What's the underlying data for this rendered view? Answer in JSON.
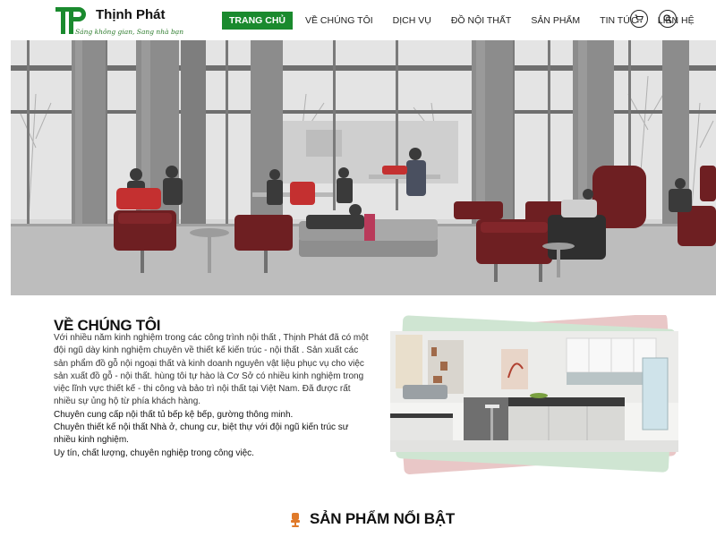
{
  "brand": {
    "name": "Thịnh Phát",
    "tagline": "Sáng không gian, Sang nhà bạn",
    "green": "#1a8a2e"
  },
  "nav": {
    "items": [
      "TRANG CHỦ",
      "VỀ CHÚNG TÔI",
      "DỊCH VỤ",
      "ĐỒ NỘI THẤT",
      "SẢN PHẨM",
      "TIN TỨC",
      "LIÊN HỆ"
    ],
    "active_index": 0,
    "cart_icon": "cart-icon",
    "search_icon": "search-icon"
  },
  "about": {
    "title": "VỀ CHÚNG TÔI",
    "paragraph": "Với nhiều năm kinh nghiệm trong các công trình nội thất , Thịnh Phát đã có một đội ngũ dày kinh nghiệm chuyên về thiết kế kiến trúc - nội thất . Sản xuất các sản phẩm đồ gỗ nội ngoại thất và kinh doanh nguyên vật liệu phục vụ cho việc sản xuất đồ gỗ - nội thất. hùng tôi tự hào là Cơ Sở có nhiều kinh nghiệm trong việc lĩnh vực thiết kế - thi công và bảo trì nội thất tại Việt Nam. Đã được rất nhiều sự ủng hộ từ phía khách hàng.",
    "bullets": [
      "Chuyên cung cấp nội thất tủ bếp kệ bếp, gường thông minh.",
      "Chuyên thiết kế nội thất Nhà ở, chung cư, biệt thự với đội ngũ kiến trúc sư nhiều kinh nghiệm.",
      "Uy tín, chất lượng, chuyên nghiệp trong công việc."
    ]
  },
  "products": {
    "title": "SẢN PHẨM NỔI BẬT",
    "icon": "chair-icon",
    "accent": "#e07a2a"
  }
}
